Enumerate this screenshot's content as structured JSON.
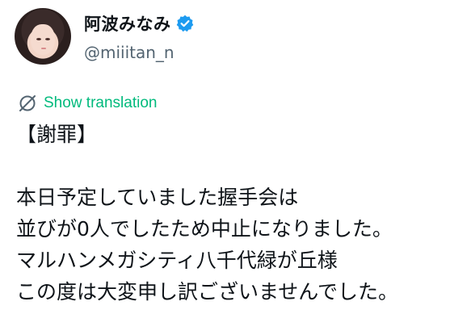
{
  "user": {
    "display_name": "阿波みなみ",
    "handle": "@miiitan_n",
    "verified_icon": "verified-badge-icon",
    "verified_color": "#1d9bf0"
  },
  "translation": {
    "label": "Show translation",
    "icon": "globe-slash-icon",
    "color": "#00ba7c"
  },
  "tweet": {
    "line1": "【謝罪】",
    "line2": "本日予定していました握手会は",
    "line3": "並びが0人でしたため中止になりました。",
    "line4": "マルハンメガシティ八千代緑が丘様",
    "line5": "この度は大変申し訳ございませんでした。"
  }
}
